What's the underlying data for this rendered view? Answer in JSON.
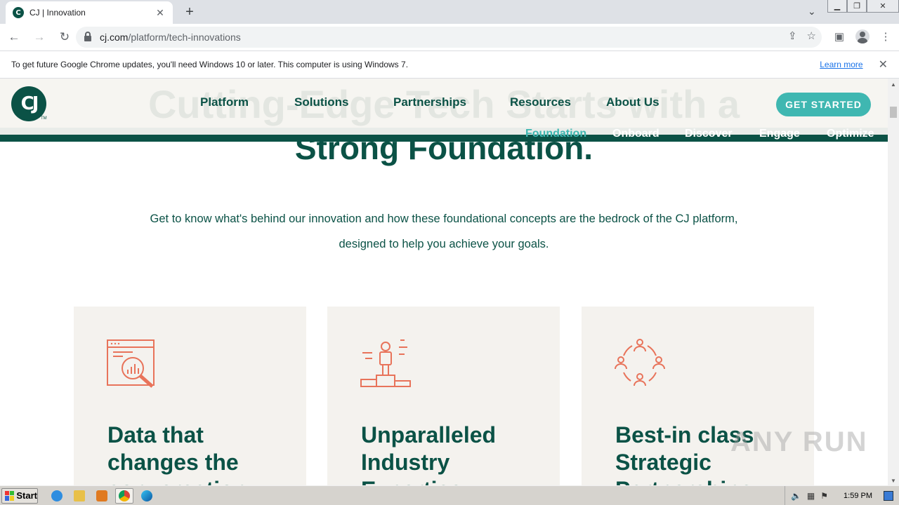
{
  "browser": {
    "tab_title": "CJ | Innovation",
    "tab_favicon_text": "C",
    "url_host": "cj.com",
    "url_path": "/platform/tech-innovations",
    "infobar_text": "To get future Google Chrome updates, you'll need Windows 10 or later. This computer is using Windows 7.",
    "infobar_link": "Learn more"
  },
  "site": {
    "logo_text": "CJ",
    "logo_tm": "TM",
    "ghost_heading": "Cutting-Edge Tech Starts with a",
    "nav": [
      "Platform",
      "Solutions",
      "Partnerships",
      "Resources",
      "About Us"
    ],
    "cta": "GET STARTED",
    "subnav": [
      "Foundation",
      "Onboard",
      "Discover",
      "Engage",
      "Optimize"
    ],
    "heading": "Strong Foundation.",
    "intro": "Get to know what's behind our innovation and how these foundational concepts are the bedrock of the CJ platform, designed to help you achieve your goals.",
    "cards": [
      {
        "title": "Data that changes the conversation",
        "icon": "data-analytics-icon"
      },
      {
        "title": "Unparalleled Industry Expertise",
        "icon": "expert-podium-icon"
      },
      {
        "title": "Best-in class Strategic Partnerships",
        "icon": "partner-network-icon"
      }
    ],
    "colors": {
      "brand": "#0b5246",
      "accent": "#3fb7b1",
      "icon": "#e8735a",
      "card_bg": "#f4f2ee"
    }
  },
  "watermark": "ANY RUN",
  "taskbar": {
    "start_label": "Start",
    "clock": "1:59 PM"
  }
}
